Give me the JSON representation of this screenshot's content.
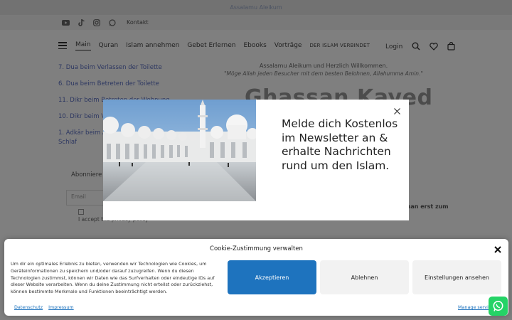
{
  "announcement": "Assalamu Aleikum",
  "social": {
    "icons": [
      "youtube-icon",
      "tiktok-icon",
      "instagram-icon",
      "whatsapp-icon"
    ],
    "kontakt": "Kontakt"
  },
  "nav": {
    "items": [
      "Main",
      "Quran",
      "Islam annehmen",
      "Gebet Erlernen",
      "Ebooks",
      "Vorträge",
      "DER ISLAM VERBINDET"
    ],
    "login": "Login"
  },
  "sidebar": {
    "links": [
      "7. Dua beim Verlassen der Toilette",
      "6. Dua beim Betreten der Toilette",
      "11. Dikr beim Betreten der Wohnung",
      "10. Dikr beim V",
      "1. Adkâr beim A",
      "Schlaf"
    ],
    "subscribe_label": "Abonniere",
    "email_placeholder": "Email",
    "privacy_label": "I accept the privacy policy"
  },
  "hero": {
    "greeting": "Assalamu Aleikum und Herzlich Willkommen.",
    "quote": "\"Möge Allah jeden Besucher mit dem besten Belohnen, Allahumma Amin.\"",
    "brand": "Ghassan Kayed",
    "side_text": "man erst zum"
  },
  "modal": {
    "headline": "Melde dich Kostenlos im Newsletter an & erhalte Nachrichten rund um den Islam."
  },
  "cookie": {
    "title": "Cookie-Zustimmung verwalten",
    "body": "Um dir ein optimales Erlebnis zu bieten, verwenden wir Technologien wie Cookies, um Geräteinformationen zu speichern und/oder darauf zuzugreifen. Wenn du diesen Technologien zustimmst, können wir Daten wie das Surfverhalten oder eindeutige IDs auf dieser Website verarbeiten. Wenn du deine Zustimmung nicht erteilst oder zurückziehst, können bestimmte Merkmale und Funktionen beeinträchtigt werden.",
    "accept": "Akzeptieren",
    "deny": "Ablehnen",
    "settings": "Einstellungen ansehen",
    "links": [
      "Datenschutz",
      "Impressum"
    ],
    "manage": "Manage services"
  },
  "colors": {
    "accent": "#1e73be",
    "link": "#5b6fc2",
    "whatsapp": "#25d366"
  }
}
